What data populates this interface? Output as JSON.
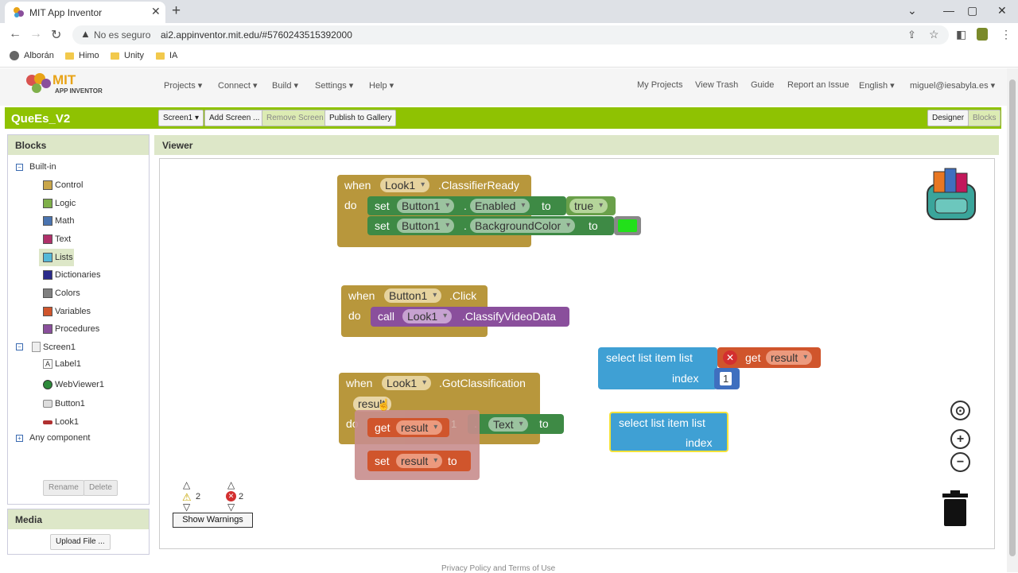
{
  "browser": {
    "tab_title": "MIT App Inventor",
    "close_glyph": "✕",
    "new_tab_glyph": "+",
    "window_controls": [
      "⌄",
      "—",
      "▢",
      "✕"
    ],
    "security_label": "No es seguro",
    "url": "ai2.appinventor.mit.edu/#5760243515392000",
    "bookmarks": [
      "Alborán",
      "Himo",
      "Unity",
      "IA"
    ]
  },
  "app": {
    "logo_mit": "MIT",
    "logo_sub": "APP INVENTOR",
    "menu_left": [
      "Projects ▾",
      "Connect ▾",
      "Build ▾",
      "Settings ▾",
      "Help ▾"
    ],
    "menu_right": [
      "My Projects",
      "View Trash",
      "Guide",
      "Report an Issue",
      "English ▾",
      "miguel@iesabyla.es ▾"
    ],
    "project_name": "QueEs_V2",
    "toolbar": {
      "screen_select": "Screen1 ▾",
      "add_screen": "Add Screen ...",
      "remove_screen": "Remove Screen",
      "publish": "Publish to Gallery",
      "designer": "Designer",
      "blocks": "Blocks"
    }
  },
  "blocks_panel": {
    "title": "Blocks",
    "builtin_label": "Built-in",
    "builtin": [
      {
        "label": "Control",
        "color": "#c9a64a"
      },
      {
        "label": "Logic",
        "color": "#7fb04a"
      },
      {
        "label": "Math",
        "color": "#4a74b0"
      },
      {
        "label": "Text",
        "color": "#b0306a"
      },
      {
        "label": "Lists",
        "color": "#55b8d8"
      },
      {
        "label": "Dictionaries",
        "color": "#2a2a8a"
      },
      {
        "label": "Colors",
        "color": "#808080"
      },
      {
        "label": "Variables",
        "color": "#d0552c"
      },
      {
        "label": "Procedures",
        "color": "#8a4f9c"
      }
    ],
    "screen_label": "Screen1",
    "components": [
      "Label1",
      "WebViewer1",
      "Button1",
      "Look1"
    ],
    "any_component": "Any component",
    "rename": "Rename",
    "delete": "Delete"
  },
  "media_panel": {
    "title": "Media",
    "upload": "Upload File ..."
  },
  "viewer": {
    "title": "Viewer",
    "warnings_count": "2",
    "errors_count": "2",
    "show_warnings": "Show Warnings",
    "footer_text": "Privacy Policy and Terms of Use"
  },
  "blocks": {
    "when": "when",
    "do": "do",
    "set": "set",
    "to": "to",
    "call": "call",
    "get": "get",
    "dot": ".",
    "b1_comp": "Look1",
    "b1_event": ".ClassifierReady",
    "b1_s1_comp": "Button1",
    "b1_s1_prop": "Enabled",
    "b1_s1_val": "true",
    "b1_s2_comp": "Button1",
    "b1_s2_prop": "BackgroundColor",
    "b1_s2_color": "#22e01a",
    "b2_comp": "Button1",
    "b2_event": ".Click",
    "b2_call_comp": "Look1",
    "b2_call_method": ".ClassifyVideoData",
    "b3_comp": "Look1",
    "b3_event": ".GotClassification",
    "b3_param": "result",
    "b3_prop": "Text",
    "b3_hidden_num": "1",
    "hover_get_var": "result",
    "hover_set_var": "result",
    "sel1_label": "select list item  list",
    "sel1_index": "index",
    "sel1_get_var": "result",
    "sel1_num": "1",
    "sel2_label": "select list item  list",
    "sel2_index": "index"
  }
}
